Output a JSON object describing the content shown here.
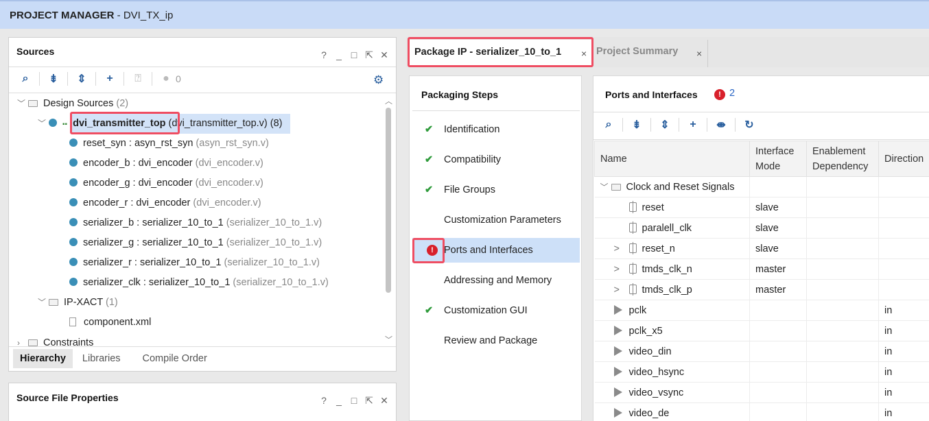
{
  "header": {
    "title_bold": "PROJECT MANAGER",
    "title_rest": " - DVI_TX_ip"
  },
  "sources": {
    "title": "Sources",
    "win_icons": [
      "?",
      "_",
      "□",
      "⇱",
      "✕"
    ],
    "toolbar": {
      "count": "0"
    },
    "tree": {
      "design_sources": {
        "label": "Design Sources",
        "count": "(2)"
      },
      "top": {
        "name": "dvi_transmitter_top",
        "file": "(dvi_transmitter_top.v)",
        "count": "(8)"
      },
      "children": [
        {
          "inst": "reset_syn : asyn_rst_syn",
          "file": "(asyn_rst_syn.v)"
        },
        {
          "inst": "encoder_b : dvi_encoder",
          "file": "(dvi_encoder.v)"
        },
        {
          "inst": "encoder_g : dvi_encoder",
          "file": "(dvi_encoder.v)"
        },
        {
          "inst": "encoder_r : dvi_encoder",
          "file": "(dvi_encoder.v)"
        },
        {
          "inst": "serializer_b : serializer_10_to_1",
          "file": "(serializer_10_to_1.v)"
        },
        {
          "inst": "serializer_g : serializer_10_to_1",
          "file": "(serializer_10_to_1.v)"
        },
        {
          "inst": "serializer_r : serializer_10_to_1",
          "file": "(serializer_10_to_1.v)"
        },
        {
          "inst": "serializer_clk : serializer_10_to_1",
          "file": "(serializer_10_to_1.v)"
        }
      ],
      "ipxact": {
        "label": "IP-XACT",
        "count": "(1)"
      },
      "component": "component.xml",
      "constraints": "Constraints"
    },
    "bottom_tabs": [
      "Hierarchy",
      "Libraries",
      "Compile Order"
    ]
  },
  "source_props": {
    "title": "Source File Properties"
  },
  "editor_tabs": [
    {
      "label": "Package IP - serializer_10_to_1",
      "close": "×"
    },
    {
      "label": "Project Summary",
      "close": "×"
    }
  ],
  "steps": {
    "title": "Packaging Steps",
    "items": [
      {
        "label": "Identification",
        "mark": "✔"
      },
      {
        "label": "Compatibility",
        "mark": "✔"
      },
      {
        "label": "File Groups",
        "mark": "✔"
      },
      {
        "label": "Customization Parameters",
        "mark": ""
      },
      {
        "label": "Ports and Interfaces",
        "mark": "!"
      },
      {
        "label": "Addressing and Memory",
        "mark": ""
      },
      {
        "label": "Customization GUI",
        "mark": "✔"
      },
      {
        "label": "Review and Package",
        "mark": ""
      }
    ]
  },
  "ports": {
    "title": "Ports and Interfaces",
    "error_count": "2",
    "columns": [
      "Name",
      "Interface Mode",
      "Enablement Dependency",
      "Direction"
    ],
    "group": "Clock and Reset Signals",
    "interfaces": [
      {
        "name": "reset",
        "mode": "slave",
        "expand": ""
      },
      {
        "name": "paralell_clk",
        "mode": "slave",
        "expand": ""
      },
      {
        "name": "reset_n",
        "mode": "slave",
        "expand": ">"
      },
      {
        "name": "tmds_clk_n",
        "mode": "master",
        "expand": ">"
      },
      {
        "name": "tmds_clk_p",
        "mode": "master",
        "expand": ">"
      }
    ],
    "rows": [
      {
        "name": "pclk",
        "dir": "in"
      },
      {
        "name": "pclk_x5",
        "dir": "in"
      },
      {
        "name": "video_din",
        "dir": "in"
      },
      {
        "name": "video_hsync",
        "dir": "in"
      },
      {
        "name": "video_vsync",
        "dir": "in"
      },
      {
        "name": "video_de",
        "dir": "in"
      }
    ]
  }
}
